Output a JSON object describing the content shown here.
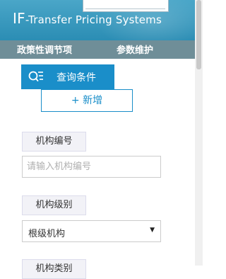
{
  "header": {
    "title_prefix": "IF",
    "title_rest": "-Transfer Pricing Systems"
  },
  "nav": {
    "items": [
      {
        "label": "政策性调节项"
      },
      {
        "label": "参数维护"
      }
    ]
  },
  "toolbar": {
    "query_label": "查询条件",
    "add_label": "+ 新增"
  },
  "form": {
    "org_code_label": "机构编号",
    "org_code_placeholder": "请输入机构编号",
    "org_level_label": "机构级别",
    "org_level_value": "根级机构",
    "org_type_label": "机构类别"
  },
  "colors": {
    "header_bg": "#2b8db4",
    "nav_bg": "#6f8e98",
    "accent": "#1a8ec9"
  }
}
